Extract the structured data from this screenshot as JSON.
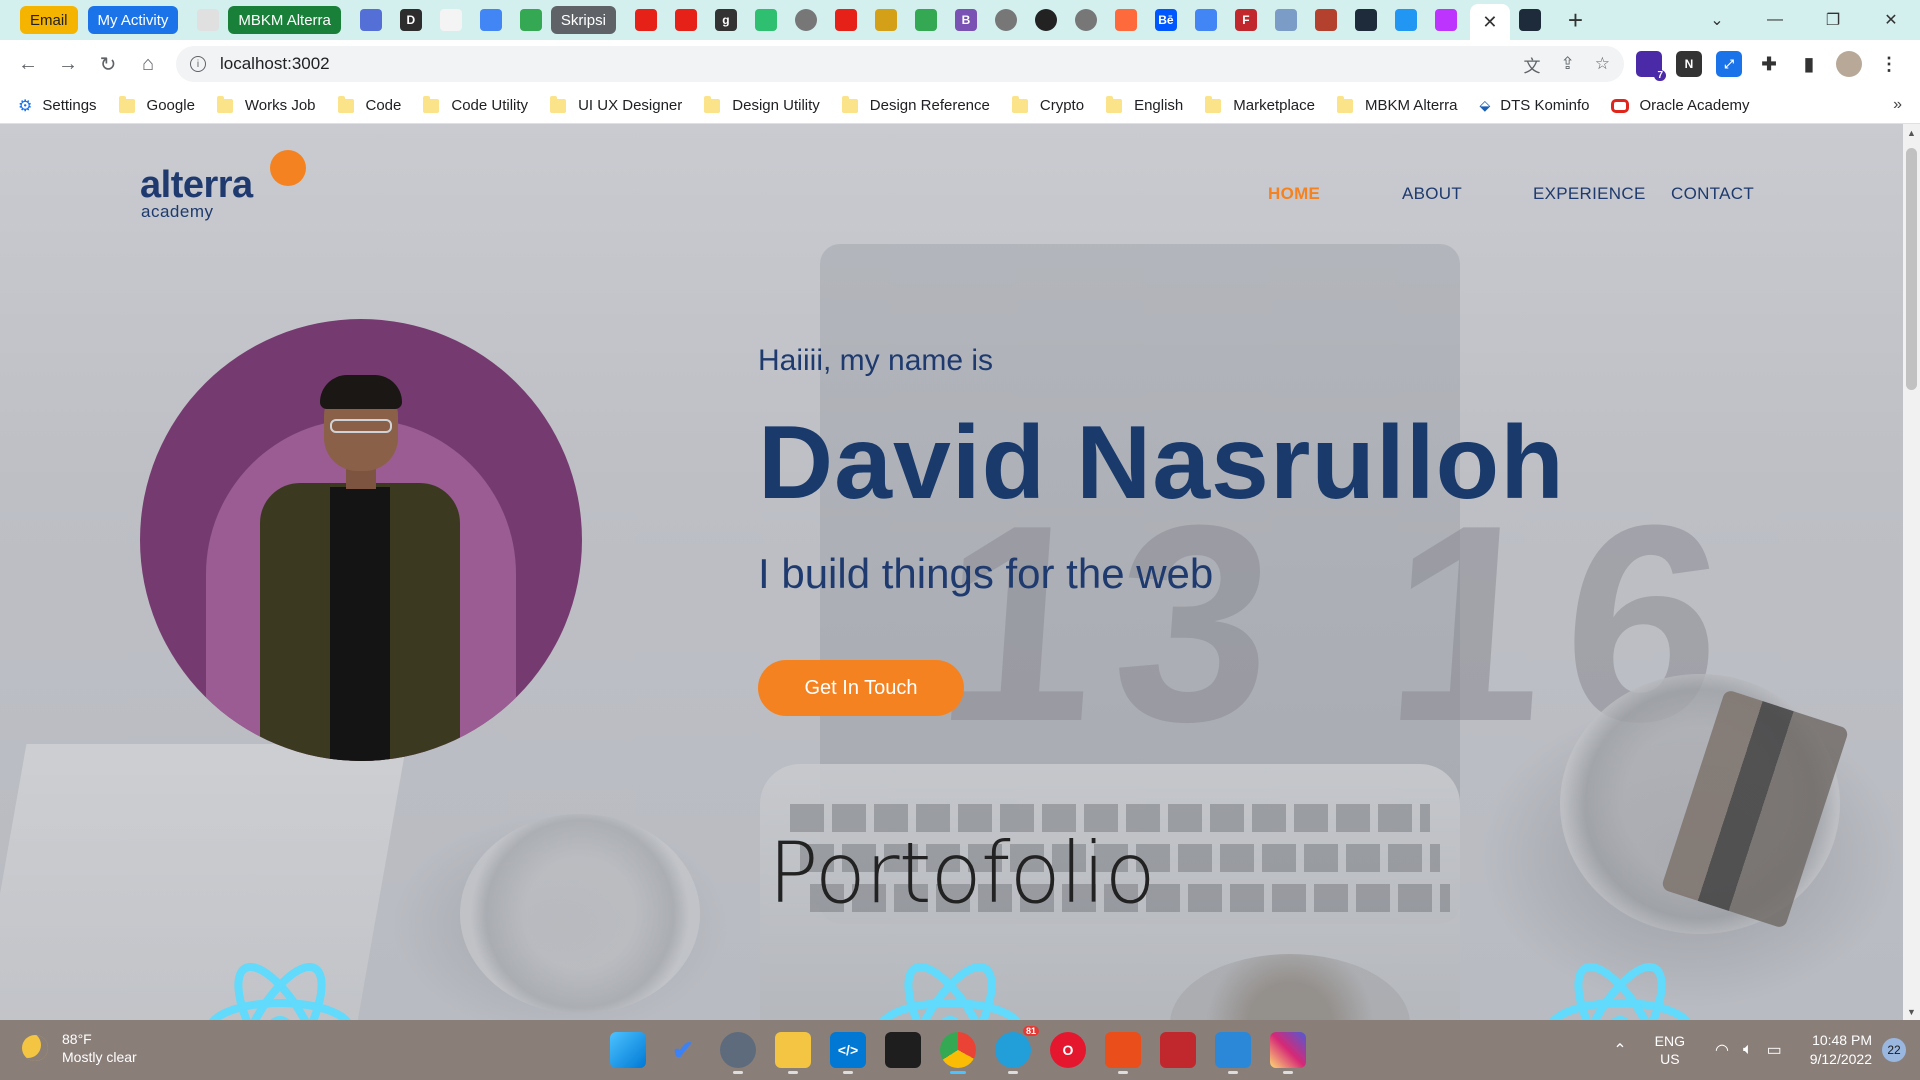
{
  "browser": {
    "tab_pills": {
      "email": "Email",
      "activity": "My Activity",
      "mbkm": "MBKM Alterra",
      "skripsi": "Skripsi"
    },
    "active_tab_close": "✕",
    "new_tab": "+",
    "url": "localhost:3002",
    "bookmarks": [
      {
        "label": "Settings",
        "icon": "gear-icon"
      },
      {
        "label": "Google",
        "icon": "folder-icon"
      },
      {
        "label": "Works Job",
        "icon": "folder-icon"
      },
      {
        "label": "Code",
        "icon": "folder-icon"
      },
      {
        "label": "Code Utility",
        "icon": "folder-icon"
      },
      {
        "label": "UI UX Designer",
        "icon": "folder-icon"
      },
      {
        "label": "Design Utility",
        "icon": "folder-icon"
      },
      {
        "label": "Design Reference",
        "icon": "folder-icon"
      },
      {
        "label": "Crypto",
        "icon": "folder-icon"
      },
      {
        "label": "English",
        "icon": "folder-icon"
      },
      {
        "label": "Marketplace",
        "icon": "folder-icon"
      },
      {
        "label": "MBKM Alterra",
        "icon": "folder-icon"
      },
      {
        "label": "DTS Kominfo",
        "icon": "dts-icon"
      },
      {
        "label": "Oracle Academy",
        "icon": "oracle-icon"
      }
    ],
    "extension_badge": "7"
  },
  "site": {
    "logo": {
      "word": "alterra",
      "sub": "academy"
    },
    "nav": {
      "home": "HOME",
      "about": "ABOUT",
      "experience": "EXPERIENCE",
      "contact": "CONTACT"
    },
    "hero": {
      "intro": "Haiiii, my name is",
      "name": "David Nasrulloh",
      "tagline": "I build things for the web",
      "cta": "Get In Touch"
    },
    "portfolio_title": "Portofolio",
    "background_text": "13 16"
  },
  "taskbar": {
    "weather_temp": "88°F",
    "weather_desc": "Mostly clear",
    "lang_top": "ENG",
    "lang_bottom": "US",
    "time": "10:48 PM",
    "date": "9/12/2022",
    "notifications": "22",
    "telegram_badge": "81"
  },
  "colors": {
    "accent": "#f58220",
    "navy": "#1a3a6c",
    "avatar_bg": "#753b70",
    "react_blue": "#61dafb"
  }
}
